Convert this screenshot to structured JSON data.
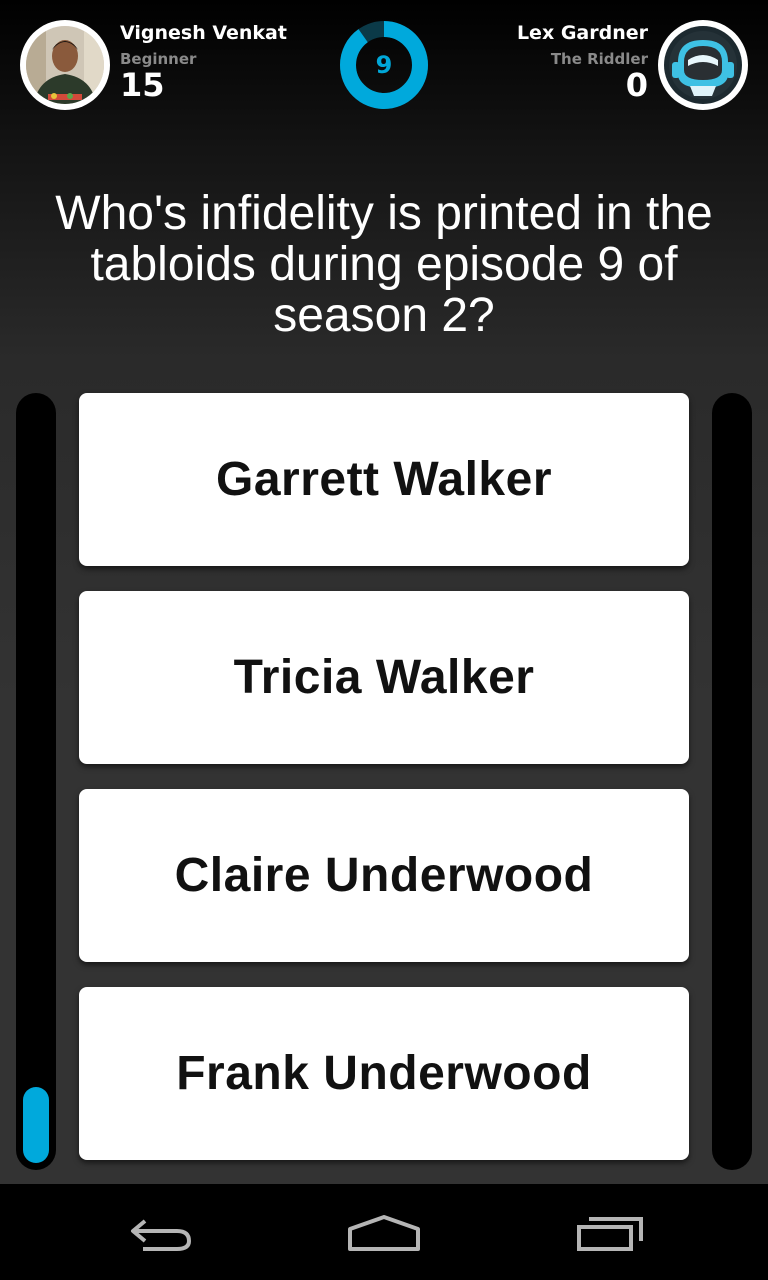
{
  "player_left": {
    "name": "Vignesh Venkat",
    "rank": "Beginner",
    "score": "15"
  },
  "player_right": {
    "name": "Lex Gardner",
    "rank": "The Riddler",
    "score": "0"
  },
  "timer": {
    "value": "9",
    "remaining_fraction": 0.9
  },
  "question": "Who's infidelity is printed in the tabloids during episode 9 of season 2?",
  "answers": [
    "Garrett Walker",
    "Tricia Walker",
    "Claire Underwood",
    "Frank Underwood"
  ],
  "progress": {
    "left_fraction": 0.1,
    "right_fraction": 0
  },
  "colors": {
    "accent": "#00a9dc",
    "background": "#333333",
    "answer_bg": "#ffffff"
  },
  "nav": {
    "icons": [
      "back-icon",
      "home-icon",
      "recent-apps-icon"
    ]
  }
}
